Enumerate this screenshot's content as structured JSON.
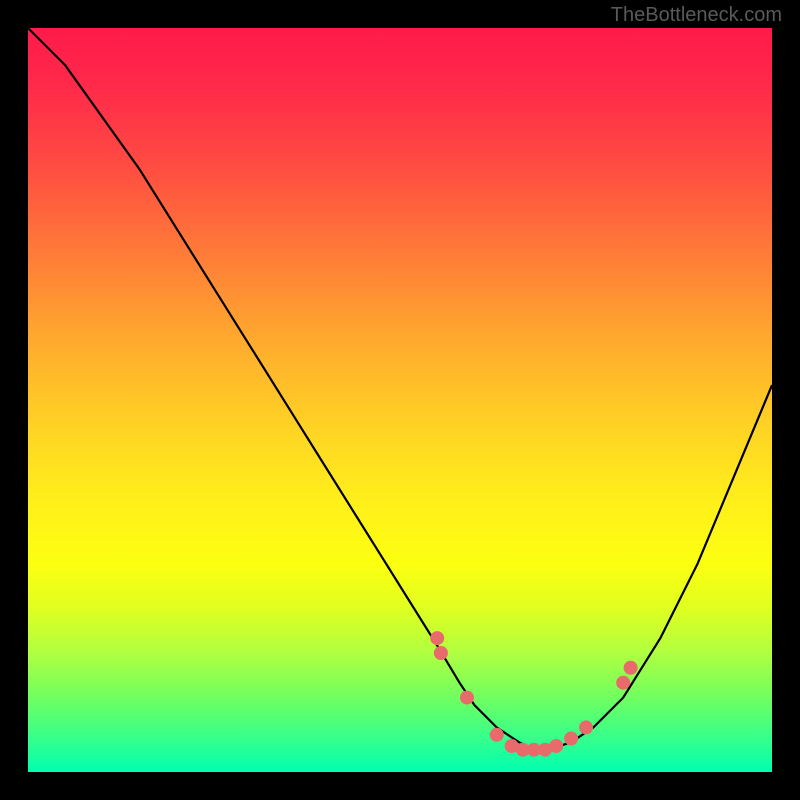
{
  "watermark": "TheBottleneck.com",
  "chart_data": {
    "type": "line",
    "title": "",
    "xlabel": "",
    "ylabel": "",
    "xlim": [
      0,
      100
    ],
    "ylim": [
      0,
      100
    ],
    "series": [
      {
        "name": "bottleneck-curve",
        "x": [
          0,
          5,
          10,
          15,
          20,
          25,
          30,
          35,
          40,
          45,
          50,
          55,
          58,
          60,
          63,
          66,
          68,
          70,
          73,
          76,
          80,
          85,
          90,
          95,
          100
        ],
        "y": [
          100,
          95,
          88,
          81,
          73,
          65,
          57,
          49,
          41,
          33,
          25,
          17,
          12,
          9,
          6,
          4,
          3,
          3,
          4,
          6,
          10,
          18,
          28,
          40,
          52
        ]
      }
    ],
    "markers": {
      "name": "highlight-points",
      "x": [
        55,
        55.5,
        59,
        63,
        65,
        66.5,
        68,
        69.5,
        71,
        73,
        75,
        80,
        81
      ],
      "y": [
        18,
        16,
        10,
        5,
        3.5,
        3,
        3,
        3,
        3.5,
        4.5,
        6,
        12,
        14
      ]
    },
    "gradient_stops": [
      {
        "pos": 0,
        "color": "#ff1a4a"
      },
      {
        "pos": 50,
        "color": "#ffd424"
      },
      {
        "pos": 100,
        "color": "#00ffb0"
      }
    ]
  }
}
